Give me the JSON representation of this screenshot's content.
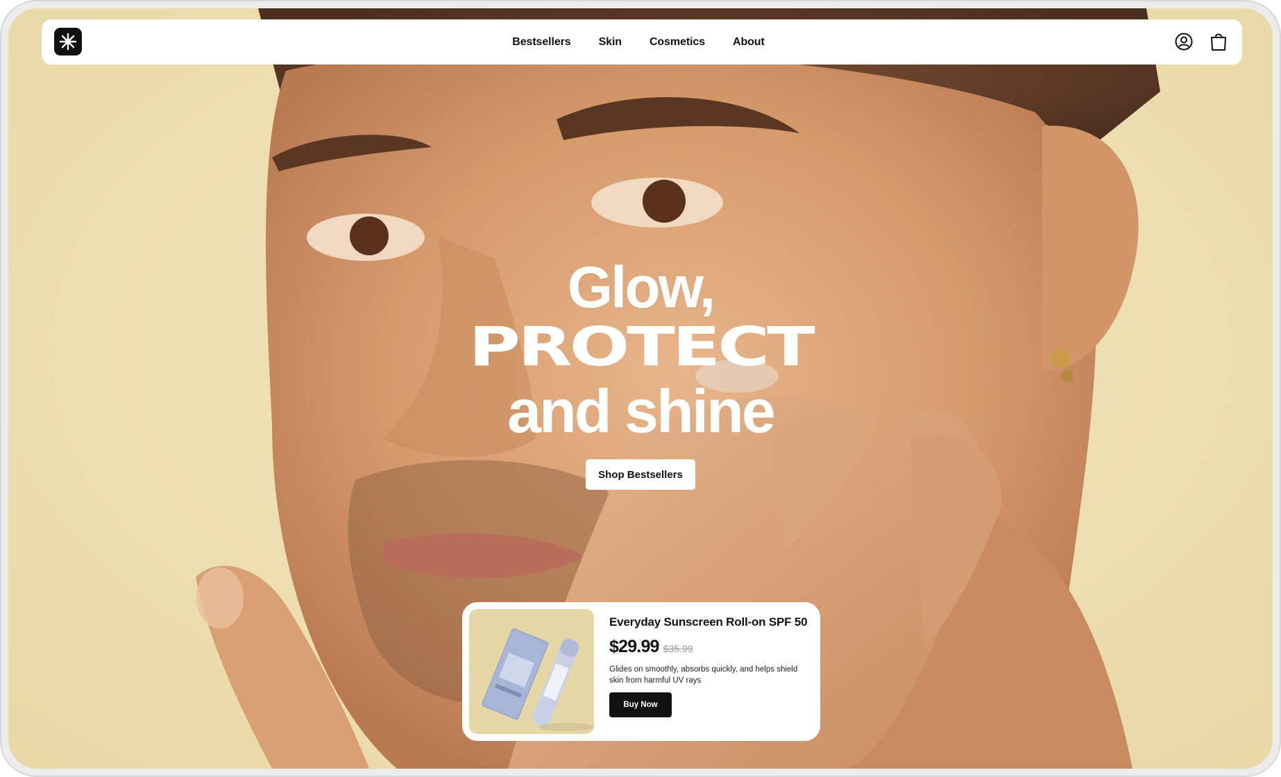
{
  "nav": {
    "links": [
      "Bestsellers",
      "Skin",
      "Cosmetics",
      "About"
    ],
    "icons": [
      "account-icon",
      "shopping-bag-icon"
    ]
  },
  "hero": {
    "headline_line1": "Glow,",
    "headline_line2": "PROTECT",
    "headline_line3": "and shine",
    "cta_label": "Shop Bestsellers"
  },
  "product": {
    "name": "Everyday Sunscreen Roll-on SPF 50",
    "price": "$29.99",
    "old_price": "$35.99",
    "description": "Glides on smoothly, absorbs quickly, and helps shield skin from harmful UV rays",
    "buy_label": "Buy Now"
  },
  "colors": {
    "background": "#efe2b6",
    "skin": "#d9a173",
    "text_dark": "#111111",
    "white": "#ffffff"
  }
}
